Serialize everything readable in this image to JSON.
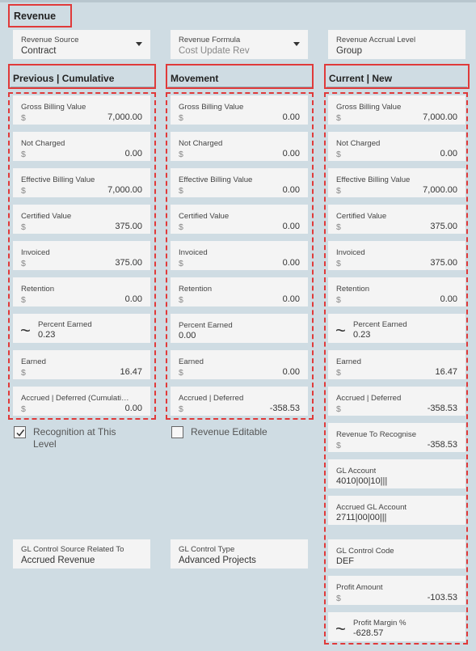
{
  "section_title": "Revenue",
  "top_fields": {
    "revenue_source": {
      "label": "Revenue Source",
      "value": "Contract"
    },
    "revenue_formula": {
      "label": "Revenue Formula",
      "value": "Cost Update Rev"
    },
    "revenue_accrual_level": {
      "label": "Revenue Accrual Level",
      "value": "Group"
    }
  },
  "columns": {
    "previous": {
      "heading": "Previous | Cumulative",
      "fields": [
        {
          "label": "Gross Billing Value",
          "currency": "$",
          "value": "7,000.00"
        },
        {
          "label": "Not Charged",
          "currency": "$",
          "value": "0.00"
        },
        {
          "label": "Effective Billing Value",
          "currency": "$",
          "value": "7,000.00"
        },
        {
          "label": "Certified Value",
          "currency": "$",
          "value": "375.00"
        },
        {
          "label": "Invoiced",
          "currency": "$",
          "value": "375.00"
        },
        {
          "label": "Retention",
          "currency": "$",
          "value": "0.00"
        },
        {
          "label": "Percent Earned",
          "value": "0.23"
        },
        {
          "label": "Earned",
          "currency": "$",
          "value": "16.47"
        },
        {
          "label": "Accrued | Deferred (Cumulati…",
          "currency": "$",
          "value": "0.00"
        }
      ]
    },
    "movement": {
      "heading": "Movement",
      "fields": [
        {
          "label": "Gross Billing Value",
          "currency": "$",
          "value": "0.00"
        },
        {
          "label": "Not Charged",
          "currency": "$",
          "value": "0.00"
        },
        {
          "label": "Effective Billing Value",
          "currency": "$",
          "value": "0.00"
        },
        {
          "label": "Certified Value",
          "currency": "$",
          "value": "0.00"
        },
        {
          "label": "Invoiced",
          "currency": "$",
          "value": "0.00"
        },
        {
          "label": "Retention",
          "currency": "$",
          "value": "0.00"
        },
        {
          "label": "Percent Earned",
          "value": "0.00"
        },
        {
          "label": "Earned",
          "currency": "$",
          "value": "0.00"
        },
        {
          "label": "Accrued | Deferred",
          "currency": "$",
          "value": "-358.53"
        }
      ]
    },
    "current": {
      "heading": "Current | New",
      "fields": [
        {
          "label": "Gross Billing Value",
          "currency": "$",
          "value": "7,000.00"
        },
        {
          "label": "Not Charged",
          "currency": "$",
          "value": "0.00"
        },
        {
          "label": "Effective Billing Value",
          "currency": "$",
          "value": "7,000.00"
        },
        {
          "label": "Certified Value",
          "currency": "$",
          "value": "375.00"
        },
        {
          "label": "Invoiced",
          "currency": "$",
          "value": "375.00"
        },
        {
          "label": "Retention",
          "currency": "$",
          "value": "0.00"
        },
        {
          "label": "Percent Earned",
          "value": "0.23"
        },
        {
          "label": "Earned",
          "currency": "$",
          "value": "16.47"
        },
        {
          "label": "Accrued | Deferred",
          "currency": "$",
          "value": "-358.53"
        },
        {
          "label": "Revenue To Recognise",
          "currency": "$",
          "value": "-358.53"
        },
        {
          "label": "GL Account",
          "value": "4010|00|10|||"
        },
        {
          "label": "Accrued GL Account",
          "value": "2711|00|00|||"
        },
        {
          "label": "GL Control Code",
          "value": "DEF"
        },
        {
          "label": "Profit Amount",
          "currency": "$",
          "value": "-103.53"
        },
        {
          "label": "Profit Margin %",
          "value": "-628.57"
        }
      ]
    }
  },
  "checkboxes": {
    "recognition": {
      "label": "Recognition at This Level",
      "checked": true
    },
    "revenue_editable": {
      "label": "Revenue Editable",
      "checked": false
    }
  },
  "gl_control": {
    "source": {
      "label": "GL Control Source Related To",
      "value": "Accrued Revenue"
    },
    "type": {
      "label": "GL Control Type",
      "value": "Advanced Projects"
    }
  },
  "colors": {
    "highlight": "#e03a3a",
    "background": "#cfdce3",
    "card": "#f4f4f4"
  },
  "icons": {
    "trend": "approx-tilde-icon",
    "dropdown": "caret-down-icon",
    "check": "checkmark-icon"
  }
}
